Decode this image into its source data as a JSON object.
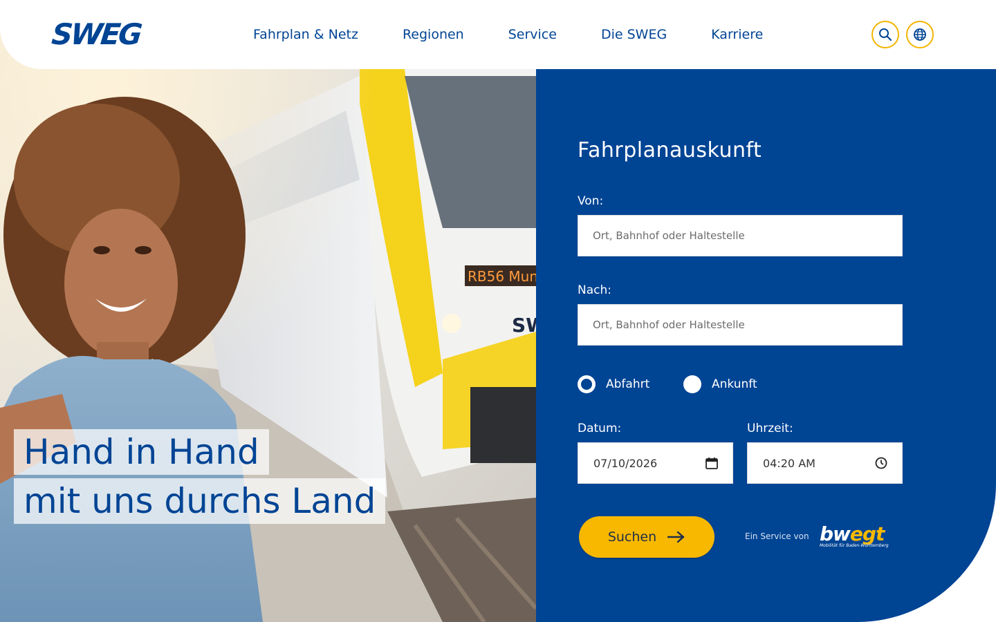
{
  "brand": {
    "logo_text": "SWEG",
    "primary_color": "#004494",
    "accent_color": "#f8b800"
  },
  "nav": {
    "items": [
      {
        "label": "Fahrplan & Netz"
      },
      {
        "label": "Regionen"
      },
      {
        "label": "Service"
      },
      {
        "label": "Die SWEG"
      },
      {
        "label": "Karriere"
      }
    ],
    "search_icon": "search-icon",
    "language_icon": "globe-icon"
  },
  "hero": {
    "headline_line1": "Hand in Hand",
    "headline_line2": "mit uns durchs Land",
    "image": "woman-with-train-photo"
  },
  "journey_form": {
    "title": "Fahrplanauskunft",
    "from_label": "Von:",
    "from_placeholder": "Ort, Bahnhof oder Haltestelle",
    "to_label": "Nach:",
    "to_placeholder": "Ort, Bahnhof oder Haltestelle",
    "radio_departure": "Abfahrt",
    "radio_arrival": "Ankunft",
    "selected_radio": "Abfahrt",
    "date_label": "Datum:",
    "date_value": "07/10/2026",
    "time_label": "Uhrzeit:",
    "time_value": "04:20 AM",
    "search_label": "Suchen",
    "service_note": "Ein Service von",
    "partner_logo_bw": "bw",
    "partner_logo_egt": "egt",
    "partner_logo_sub": "Mobilität für Baden-Württemberg"
  }
}
